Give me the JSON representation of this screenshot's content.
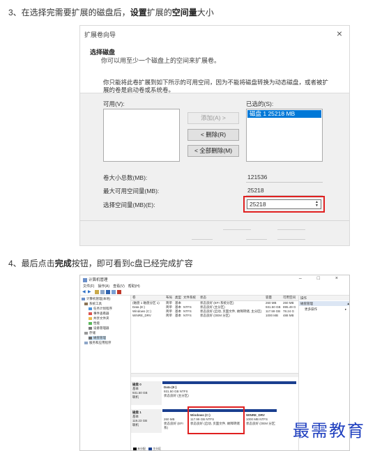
{
  "step3": {
    "prefix": "3、在选择完需要扩展的磁盘后，",
    "bold1": "设置",
    "mid": "扩展的",
    "bold2": "空间量",
    "suffix": "大小"
  },
  "step4": {
    "prefix": "4、最后点击",
    "bold": "完成",
    "suffix": "按钮，即可看到c盘已经完成扩容"
  },
  "wizard": {
    "title": "扩展卷向导",
    "close": "×",
    "header_title": "选择磁盘",
    "header_sub": "你可以用至少一个磁盘上的空间来扩展卷。",
    "desc": "你只能将此卷扩展到如下所示的可用空间，因为不能将磁盘转换为动态磁盘，或者被扩展的卷是启动卷或系统卷。",
    "available_label": "可用(V):",
    "selected_label": "已选的(S):",
    "add_button": "添加(A) >",
    "remove_button": "< 删除(R)",
    "remove_all_button": "< 全部删除(M)",
    "selected_items": [
      "磁盘 1    25218 MB"
    ],
    "total_label": "卷大小总数(MB):",
    "total_value": "121536",
    "max_label": "最大可用空间量(MB):",
    "max_value": "25218",
    "amount_label": "选择空间量(MB)(E):",
    "amount_value": "25218",
    "accent": "#0078d7",
    "highlight": "#e02020"
  },
  "cm": {
    "title": "计算机管理",
    "window_buttons": "–  □  ×",
    "menu": [
      "文件(F)",
      "操作(A)",
      "查看(V)",
      "帮助(H)"
    ],
    "tree": [
      "计算机管理(本地)",
      "系统工具",
      "任务计划程序",
      "事件查看器",
      "共享文件夹",
      "性能",
      "设备管理器",
      "存储",
      "磁盘管理",
      "服务和应用程序"
    ],
    "list_headers": [
      "卷",
      "布局",
      "类型",
      "文件系统",
      "状态",
      "容量",
      "可用空间"
    ],
    "list_rows": [
      [
        "(磁盘 1 磁盘分区 1)",
        "简单",
        "基本",
        "",
        "状态良好 (EFI 系统分区)",
        "260 MB",
        "260 MB"
      ],
      [
        "Data (E:)",
        "简单",
        "基本",
        "NTFS",
        "状态良好 (主分区)",
        "931.50 GB",
        "895.49 G"
      ],
      [
        "Windows (C:)",
        "简单",
        "基本",
        "NTFS",
        "状态良好 (启动, 页面文件, 故障转储, 主分区)",
        "117.59 GB",
        "78.24 G"
      ],
      [
        "WINRE_DRV",
        "简单",
        "基本",
        "NTFS",
        "状态良好 (OEM 分区)",
        "1000 MB",
        "488 MB"
      ]
    ],
    "disk0": {
      "name": "磁盘 0",
      "type": "基本",
      "size": "931.50 GB",
      "state": "联机",
      "part_name": "Data (E:)",
      "part_size": "931.50 GB NTFS",
      "part_state": "状态良好 (主分区)"
    },
    "disk1": {
      "name": "磁盘 1",
      "type": "基本",
      "size": "119.23 GB",
      "state": "联机",
      "p1_size": "260 MB",
      "p1_state": "状态良好 (EFI 系)",
      "p2_name": "Windows (C:)",
      "p2_size": "117.99 GB NTFS",
      "p2_state": "状态良好 (启动, 页面文件, 故障转储",
      "p3_name": "WINRE_DRV",
      "p3_size": "1000 MB NTFS",
      "p3_state": "状态良好 (OEM 分区)"
    },
    "actions_header": "操作",
    "actions_selected": "磁盘管理",
    "actions_more": "更多操作",
    "legend": [
      "未分配",
      "主分区"
    ]
  },
  "watermark": "最需教育"
}
